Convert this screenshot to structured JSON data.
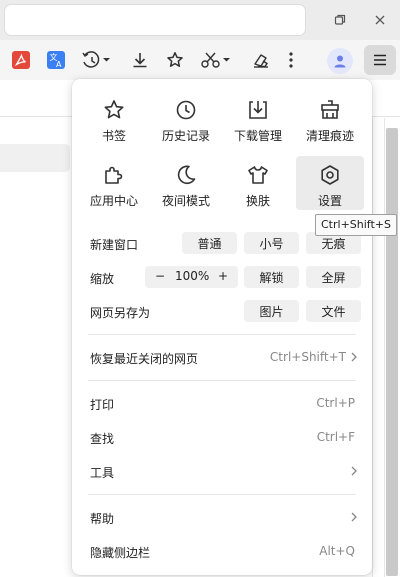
{
  "window": {
    "controls": [
      {
        "name": "minimize-icon",
        "glyph": "—"
      },
      {
        "name": "restore-icon",
        "glyph": "❐"
      },
      {
        "name": "close-icon",
        "glyph": "✕"
      }
    ]
  },
  "toolbar": {
    "extensions": [
      {
        "name": "pdf-extension-icon",
        "icon": "pdf",
        "color": "#e4483a"
      },
      {
        "name": "translate-extension-icon",
        "icon": "translate",
        "color": "#3b7ff5"
      },
      {
        "name": "history-dropdown-icon",
        "icon": "history-dropdown",
        "color": "#333333"
      },
      {
        "name": "download-icon",
        "icon": "download",
        "color": "#333333"
      },
      {
        "name": "bookmark-star-icon",
        "icon": "star",
        "color": "#333333"
      },
      {
        "name": "screenshot-scissors-icon",
        "icon": "scissors-dropdown",
        "color": "#333333"
      },
      {
        "name": "eraser-icon",
        "icon": "eraser",
        "color": "#333333"
      },
      {
        "name": "more-vertical-icon",
        "icon": "more-vertical",
        "color": "#333333"
      }
    ],
    "avatar_icon": "user-icon",
    "menu_icon": "hamburger-icon"
  },
  "menu": {
    "tiles": [
      {
        "label": "书签",
        "icon": "star-icon"
      },
      {
        "label": "历史记录",
        "icon": "clock-icon"
      },
      {
        "label": "下载管理",
        "icon": "download-icon"
      },
      {
        "label": "清理痕迹",
        "icon": "broom-icon"
      },
      {
        "label": "应用中心",
        "icon": "puzzle-icon"
      },
      {
        "label": "夜间模式",
        "icon": "moon-icon"
      },
      {
        "label": "换肤",
        "icon": "shirt-icon"
      },
      {
        "label": "设置",
        "icon": "settings-icon"
      }
    ],
    "new_window": {
      "label": "新建窗口",
      "buttons": [
        "普通",
        "小号",
        "无痕"
      ]
    },
    "zoom": {
      "label": "缩放",
      "minus": "−",
      "value": "100%",
      "plus": "+",
      "buttons": [
        "解锁",
        "全屏"
      ]
    },
    "save_as": {
      "label": "网页另存为",
      "buttons": [
        "图片",
        "文件"
      ]
    },
    "restore": {
      "label": "恢复最近关闭的网页",
      "shortcut": "Ctrl+Shift+T"
    },
    "print": {
      "label": "打印",
      "shortcut": "Ctrl+P"
    },
    "find": {
      "label": "查找",
      "shortcut": "Ctrl+F"
    },
    "tools": {
      "label": "工具"
    },
    "help": {
      "label": "帮助"
    },
    "hide_sidebar": {
      "label": "隐藏侧边栏",
      "shortcut": "Alt+Q"
    }
  },
  "tooltip": {
    "text": "Ctrl+Shift+S"
  },
  "colors": {
    "menu_bg": "#ffffff",
    "hover_tile": "#ebebeb",
    "pill_bg": "#f0f0f0",
    "shortcut_text": "#888888"
  }
}
